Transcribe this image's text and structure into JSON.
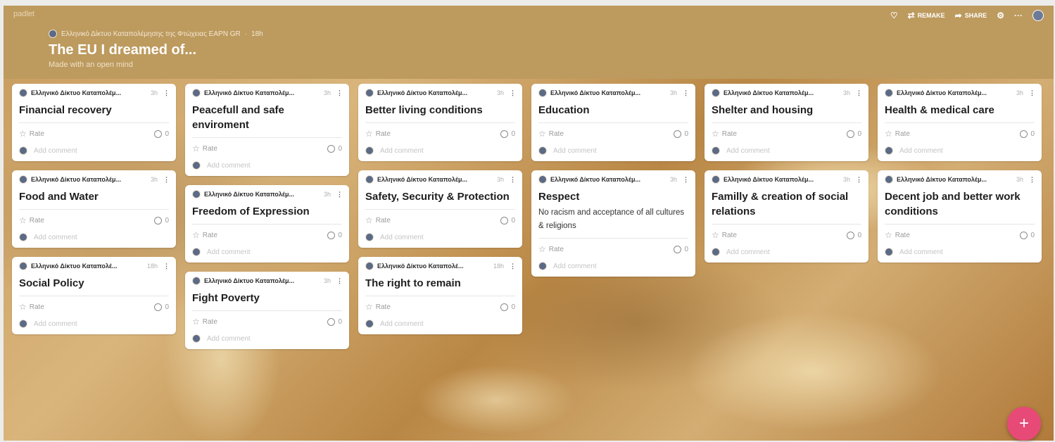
{
  "app": {
    "brand": "padlet"
  },
  "header": {
    "author": "Ελληνικό Δίκτυο Καταπολέμησης της Φτώχειας EAPN GR",
    "separator": "·",
    "time": "18h",
    "title": "The EU I dreamed of...",
    "subtitle": "Made with an open mind",
    "actions": {
      "remake": "REMAKE",
      "share": "SHARE"
    }
  },
  "labels": {
    "rate": "Rate",
    "add_comment": "Add comment",
    "kebab": "⋮",
    "fab": "+"
  },
  "board": {
    "columns": [
      {
        "cards": [
          {
            "author": "Ελληνικό Δίκτυο Καταπολέμ...",
            "time": "3h",
            "title": "Financial recovery",
            "body": "",
            "comments": "0"
          },
          {
            "author": "Ελληνικό Δίκτυο Καταπολέμ...",
            "time": "3h",
            "title": "Food and Water",
            "body": "",
            "comments": "0"
          },
          {
            "author": "Ελληνικό Δίκτυο Καταπολέ...",
            "time": "18h",
            "title": "Social Policy",
            "body": "",
            "comments": "0"
          }
        ]
      },
      {
        "cards": [
          {
            "author": "Ελληνικό Δίκτυο Καταπολέμ...",
            "time": "3h",
            "title": "Peacefull and safe enviroment",
            "body": "",
            "comments": "0"
          },
          {
            "author": "Ελληνικό Δίκτυο Καταπολέμ...",
            "time": "3h",
            "title": "Freedom of Expression",
            "body": "",
            "comments": "0"
          },
          {
            "author": "Ελληνικό Δίκτυο Καταπολέμ...",
            "time": "3h",
            "title": "Fight Poverty",
            "body": "",
            "comments": "0"
          }
        ]
      },
      {
        "cards": [
          {
            "author": "Ελληνικό Δίκτυο Καταπολέμ...",
            "time": "3h",
            "title": "Better living conditions",
            "body": "",
            "comments": "0"
          },
          {
            "author": "Ελληνικό Δίκτυο Καταπολέμ...",
            "time": "3h",
            "title": "Safety, Security & Protection",
            "body": "",
            "comments": "0"
          },
          {
            "author": "Ελληνικό Δίκτυο Καταπολέ...",
            "time": "18h",
            "title": "The right to remain",
            "body": "",
            "comments": "0"
          }
        ]
      },
      {
        "cards": [
          {
            "author": "Ελληνικό Δίκτυο Καταπολέμ...",
            "time": "3h",
            "title": "Education",
            "body": "",
            "comments": "0"
          },
          {
            "author": "Ελληνικό Δίκτυο Καταπολέμ...",
            "time": "3h",
            "title": "Respect",
            "body": "No racism and acceptance of all cultures & religions",
            "comments": "0"
          }
        ]
      },
      {
        "cards": [
          {
            "author": "Ελληνικό Δίκτυο Καταπολέμ...",
            "time": "3h",
            "title": "Shelter and housing",
            "body": "",
            "comments": "0"
          },
          {
            "author": "Ελληνικό Δίκτυο Καταπολέμ...",
            "time": "3h",
            "title": "Familly & creation of social relations",
            "body": "",
            "comments": "0"
          }
        ]
      },
      {
        "cards": [
          {
            "author": "Ελληνικό Δίκτυο Καταπολέμ...",
            "time": "3h",
            "title": "Health & medical care",
            "body": "",
            "comments": "0"
          },
          {
            "author": "Ελληνικό Δίκτυο Καταπολέμ...",
            "time": "3h",
            "title": "Decent job and better work conditions",
            "body": "",
            "comments": "0"
          }
        ]
      }
    ]
  },
  "colors": {
    "header_bg": "#bd9a5e",
    "fab": "#e84a78",
    "card_bg": "#ffffff"
  },
  "icons": {
    "like": "heart-icon",
    "remake": "remake-icon",
    "share": "share-icon",
    "settings": "gear-icon",
    "more": "more-icon"
  }
}
